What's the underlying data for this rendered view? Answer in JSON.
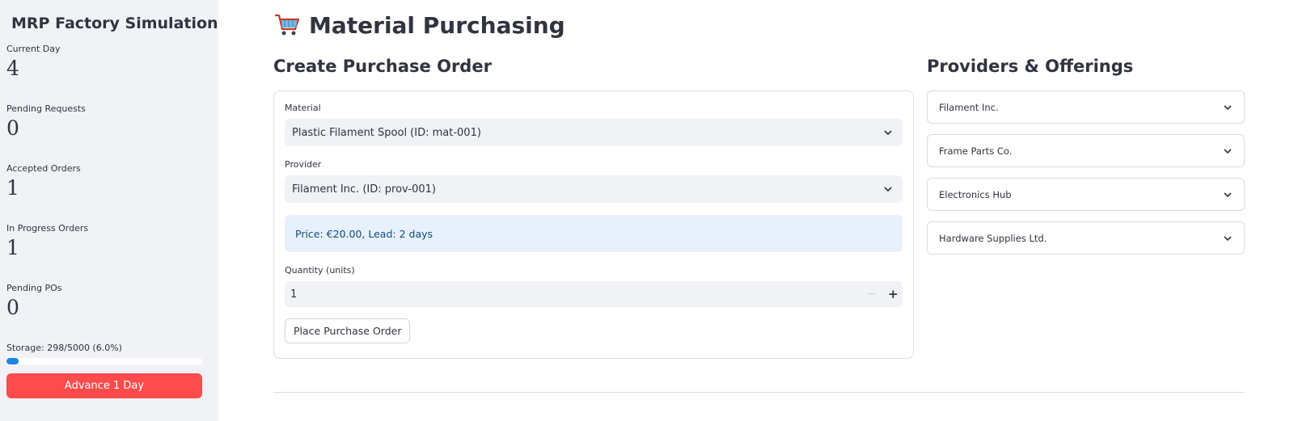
{
  "sidebar": {
    "app_title": "MRP Factory Simulation",
    "metrics": [
      {
        "label": "Current Day",
        "value": "4"
      },
      {
        "label": "Pending Requests",
        "value": "0"
      },
      {
        "label": "Accepted Orders",
        "value": "1"
      },
      {
        "label": "In Progress Orders",
        "value": "1"
      },
      {
        "label": "Pending POs",
        "value": "0"
      }
    ],
    "storage_label": "Storage: 298/5000 (6.0%)",
    "storage_fraction": 0.06,
    "advance_button": "Advance 1 Day"
  },
  "main": {
    "page_title": "Material Purchasing",
    "create_po": {
      "title": "Create Purchase Order",
      "material_label": "Material",
      "material_value": "Plastic Filament Spool (ID: mat-001)",
      "provider_label": "Provider",
      "provider_value": "Filament Inc. (ID: prov-001)",
      "info_text": "Price: €20.00, Lead: 2 days",
      "quantity_label": "Quantity (units)",
      "quantity_value": "1",
      "minus_symbol": "−",
      "plus_symbol": "+",
      "submit_button": "Place Purchase Order"
    },
    "providers": {
      "title": "Providers & Offerings",
      "items": [
        "Filament Inc.",
        "Frame Parts Co.",
        "Electronics Hub",
        "Hardware Supplies Ltd."
      ]
    }
  },
  "colors": {
    "sidebar_bg": "#f0f2f6",
    "primary_button": "#ff4b4b",
    "progress": "#1c83e1",
    "info_bg": "#e8f1fb",
    "info_text": "#0f4c81"
  },
  "icons": {
    "title_icon": "factory-icon",
    "page_icon": "shopping-cart-icon",
    "dropdown_icon": "chevron-down-icon"
  }
}
